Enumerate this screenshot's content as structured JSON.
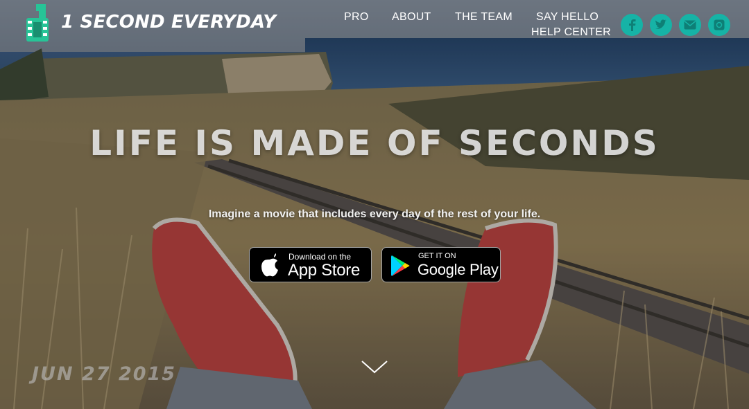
{
  "app": {
    "brand": "1 SECOND EVERYDAY",
    "logo_text": "1"
  },
  "nav": {
    "pro": "PRO",
    "about": "ABOUT",
    "team": "THE TEAM",
    "say_hello": "SAY HELLO",
    "help_center": "HELP CENTER"
  },
  "social": [
    {
      "icon": "facebook-icon"
    },
    {
      "icon": "twitter-icon"
    },
    {
      "icon": "email-icon"
    },
    {
      "icon": "instagram-icon"
    }
  ],
  "hero": {
    "headline": "LIFE IS MADE OF SECONDS",
    "subline": "Imagine a movie that includes every day of the rest of your life.",
    "date_stamp": "JUN  27  2015"
  },
  "buttons": {
    "app_store_small": "Download on the",
    "app_store_big": "App Store",
    "google_small": "GET IT ON",
    "google_big": "Google Play"
  },
  "colors": {
    "accent": "#16b3a6",
    "logo_green": "#27c497"
  }
}
